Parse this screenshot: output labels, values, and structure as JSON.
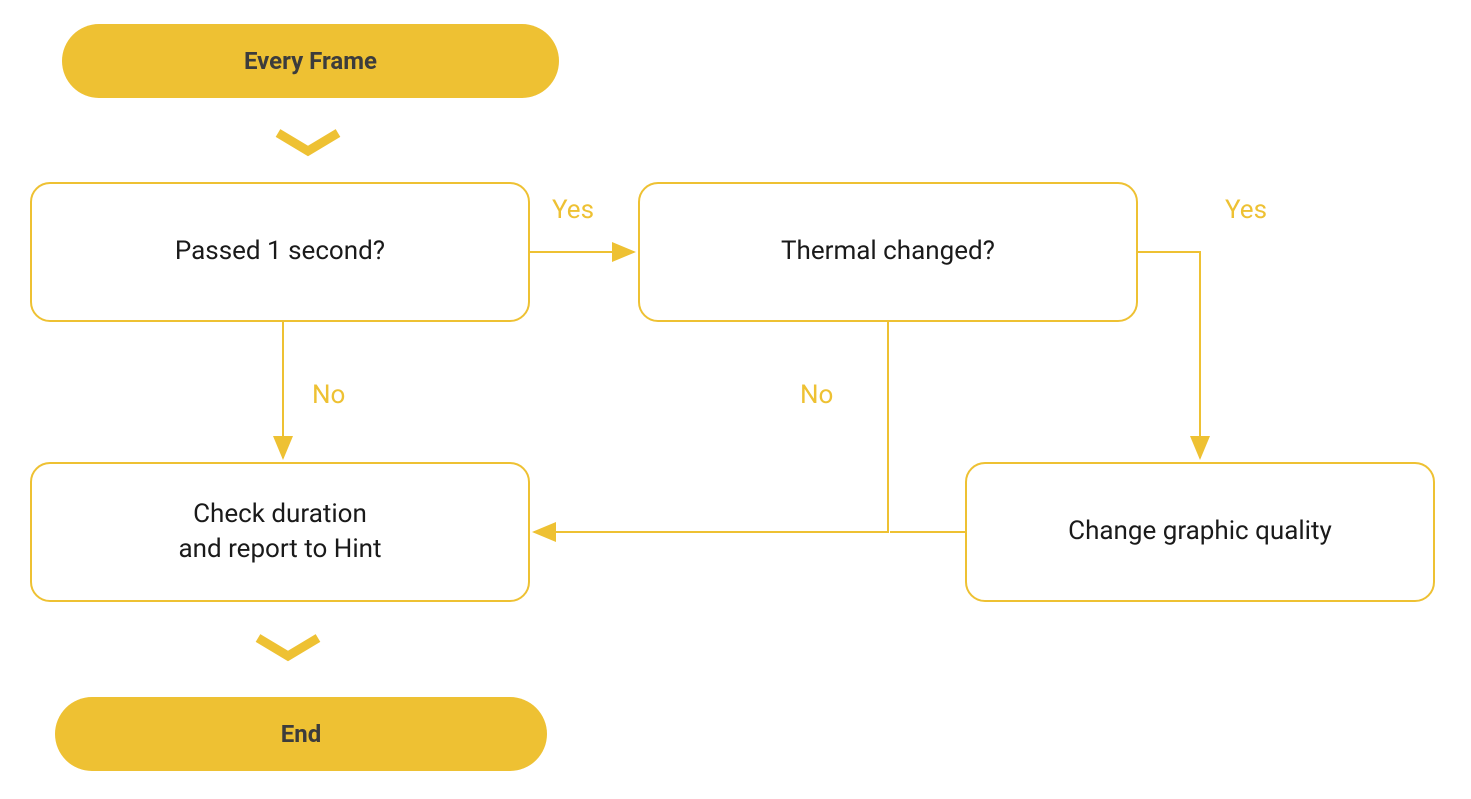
{
  "colors": {
    "accent": "#eec133",
    "node_text": "#1a1a1a",
    "terminal_text": "#3c3c3c"
  },
  "terminals": {
    "start": "Every Frame",
    "end": "End"
  },
  "decisions": {
    "passed_1_second": "Passed 1 second?",
    "thermal_changed": "Thermal changed?"
  },
  "processes": {
    "check_duration": "Check duration\nand report to Hint",
    "change_quality": "Change graphic quality"
  },
  "edge_labels": {
    "yes1": "Yes",
    "no1": "No",
    "yes2": "Yes",
    "no2": "No"
  },
  "chart_data": {
    "type": "flowchart",
    "nodes": [
      {
        "id": "start",
        "type": "terminal",
        "label": "Every Frame"
      },
      {
        "id": "passed_1_second",
        "type": "decision",
        "label": "Passed 1 second?"
      },
      {
        "id": "thermal_changed",
        "type": "decision",
        "label": "Thermal changed?"
      },
      {
        "id": "change_quality",
        "type": "process",
        "label": "Change graphic quality"
      },
      {
        "id": "check_duration",
        "type": "process",
        "label": "Check duration and report to Hint"
      },
      {
        "id": "end",
        "type": "terminal",
        "label": "End"
      }
    ],
    "edges": [
      {
        "from": "start",
        "to": "passed_1_second"
      },
      {
        "from": "passed_1_second",
        "to": "thermal_changed",
        "label": "Yes"
      },
      {
        "from": "passed_1_second",
        "to": "check_duration",
        "label": "No"
      },
      {
        "from": "thermal_changed",
        "to": "change_quality",
        "label": "Yes"
      },
      {
        "from": "thermal_changed",
        "to": "check_duration",
        "label": "No"
      },
      {
        "from": "change_quality",
        "to": "check_duration"
      },
      {
        "from": "check_duration",
        "to": "end"
      }
    ]
  }
}
